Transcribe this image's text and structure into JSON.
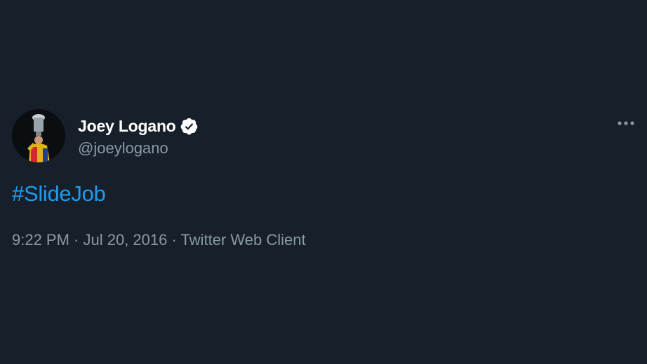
{
  "author": {
    "display_name": "Joey Logano",
    "handle": "@joeylogano",
    "verified": true,
    "avatar": "avatar-photo-trophy"
  },
  "tweet": {
    "text": "#SlideJob",
    "time": "9:22 PM",
    "separator": " · ",
    "date": "Jul 20, 2016",
    "source": "Twitter Web Client"
  },
  "icons": {
    "verified": "verified-badge-icon",
    "more": "more-horizontal-icon"
  },
  "colors": {
    "background": "#17202a",
    "link": "#1d9bf0",
    "secondary_text": "#8899a6",
    "primary_text": "#ffffff"
  }
}
